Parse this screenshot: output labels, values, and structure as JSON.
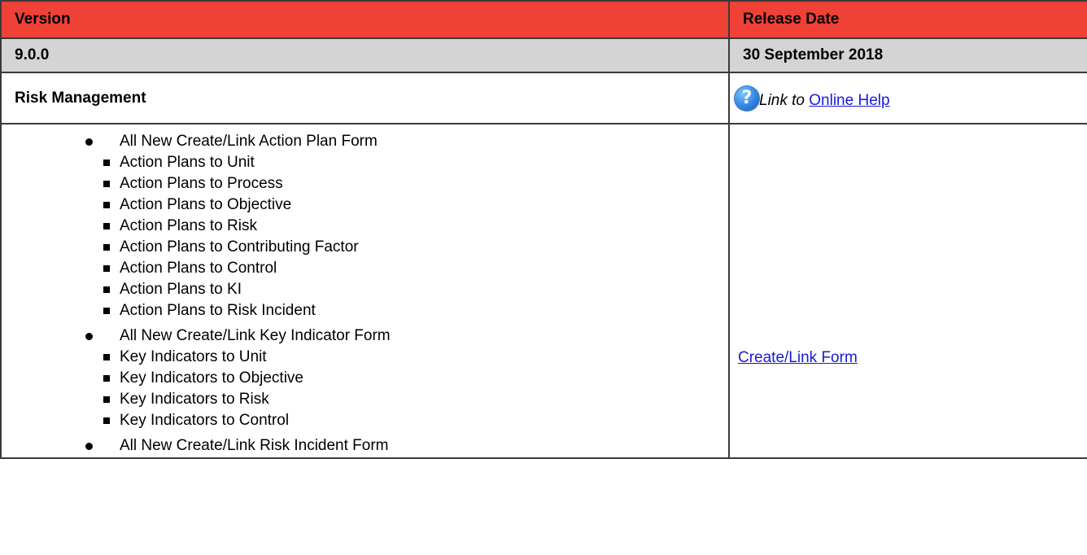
{
  "header": {
    "version_label": "Version",
    "release_date_label": "Release Date"
  },
  "version_row": {
    "version": "9.0.0",
    "release_date": "30 September 2018"
  },
  "section": {
    "title": "Risk Management",
    "help_icon": "question-mark-help-icon",
    "help_prefix": "Link to",
    "help_link": "Online Help"
  },
  "features": [
    {
      "label": "All New Create/Link Action Plan Form",
      "items": [
        "Action Plans to Unit",
        "Action Plans to Process",
        "Action Plans to Objective",
        "Action Plans to Risk",
        "Action Plans to Contributing Factor",
        "Action Plans to Control",
        "Action Plans to KI",
        "Action Plans to Risk Incident"
      ]
    },
    {
      "label": "All New Create/Link Key Indicator Form",
      "items": [
        "Key Indicators to Unit",
        "Key Indicators to Objective",
        "Key Indicators to Risk",
        "Key Indicators to Control"
      ]
    },
    {
      "label": "All New Create/Link Risk Incident Form",
      "items": []
    }
  ],
  "feature_link": "Create/Link Form",
  "colors": {
    "header_bg": "#ef4135",
    "version_bg": "#d4d4d4",
    "link": "#1a1ad6"
  }
}
